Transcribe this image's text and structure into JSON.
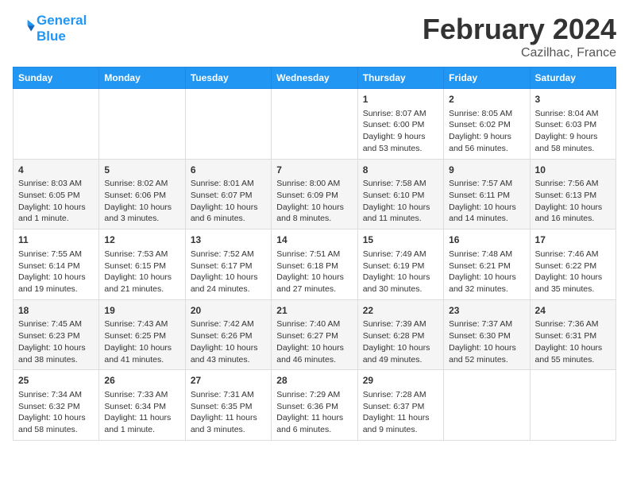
{
  "header": {
    "logo_line1": "General",
    "logo_line2": "Blue",
    "title": "February 2024",
    "subtitle": "Cazilhac, France"
  },
  "weekdays": [
    "Sunday",
    "Monday",
    "Tuesday",
    "Wednesday",
    "Thursday",
    "Friday",
    "Saturday"
  ],
  "weeks": [
    [
      {
        "day": "",
        "info": ""
      },
      {
        "day": "",
        "info": ""
      },
      {
        "day": "",
        "info": ""
      },
      {
        "day": "",
        "info": ""
      },
      {
        "day": "1",
        "info": "Sunrise: 8:07 AM\nSunset: 6:00 PM\nDaylight: 9 hours\nand 53 minutes."
      },
      {
        "day": "2",
        "info": "Sunrise: 8:05 AM\nSunset: 6:02 PM\nDaylight: 9 hours\nand 56 minutes."
      },
      {
        "day": "3",
        "info": "Sunrise: 8:04 AM\nSunset: 6:03 PM\nDaylight: 9 hours\nand 58 minutes."
      }
    ],
    [
      {
        "day": "4",
        "info": "Sunrise: 8:03 AM\nSunset: 6:05 PM\nDaylight: 10 hours\nand 1 minute."
      },
      {
        "day": "5",
        "info": "Sunrise: 8:02 AM\nSunset: 6:06 PM\nDaylight: 10 hours\nand 3 minutes."
      },
      {
        "day": "6",
        "info": "Sunrise: 8:01 AM\nSunset: 6:07 PM\nDaylight: 10 hours\nand 6 minutes."
      },
      {
        "day": "7",
        "info": "Sunrise: 8:00 AM\nSunset: 6:09 PM\nDaylight: 10 hours\nand 8 minutes."
      },
      {
        "day": "8",
        "info": "Sunrise: 7:58 AM\nSunset: 6:10 PM\nDaylight: 10 hours\nand 11 minutes."
      },
      {
        "day": "9",
        "info": "Sunrise: 7:57 AM\nSunset: 6:11 PM\nDaylight: 10 hours\nand 14 minutes."
      },
      {
        "day": "10",
        "info": "Sunrise: 7:56 AM\nSunset: 6:13 PM\nDaylight: 10 hours\nand 16 minutes."
      }
    ],
    [
      {
        "day": "11",
        "info": "Sunrise: 7:55 AM\nSunset: 6:14 PM\nDaylight: 10 hours\nand 19 minutes."
      },
      {
        "day": "12",
        "info": "Sunrise: 7:53 AM\nSunset: 6:15 PM\nDaylight: 10 hours\nand 21 minutes."
      },
      {
        "day": "13",
        "info": "Sunrise: 7:52 AM\nSunset: 6:17 PM\nDaylight: 10 hours\nand 24 minutes."
      },
      {
        "day": "14",
        "info": "Sunrise: 7:51 AM\nSunset: 6:18 PM\nDaylight: 10 hours\nand 27 minutes."
      },
      {
        "day": "15",
        "info": "Sunrise: 7:49 AM\nSunset: 6:19 PM\nDaylight: 10 hours\nand 30 minutes."
      },
      {
        "day": "16",
        "info": "Sunrise: 7:48 AM\nSunset: 6:21 PM\nDaylight: 10 hours\nand 32 minutes."
      },
      {
        "day": "17",
        "info": "Sunrise: 7:46 AM\nSunset: 6:22 PM\nDaylight: 10 hours\nand 35 minutes."
      }
    ],
    [
      {
        "day": "18",
        "info": "Sunrise: 7:45 AM\nSunset: 6:23 PM\nDaylight: 10 hours\nand 38 minutes."
      },
      {
        "day": "19",
        "info": "Sunrise: 7:43 AM\nSunset: 6:25 PM\nDaylight: 10 hours\nand 41 minutes."
      },
      {
        "day": "20",
        "info": "Sunrise: 7:42 AM\nSunset: 6:26 PM\nDaylight: 10 hours\nand 43 minutes."
      },
      {
        "day": "21",
        "info": "Sunrise: 7:40 AM\nSunset: 6:27 PM\nDaylight: 10 hours\nand 46 minutes."
      },
      {
        "day": "22",
        "info": "Sunrise: 7:39 AM\nSunset: 6:28 PM\nDaylight: 10 hours\nand 49 minutes."
      },
      {
        "day": "23",
        "info": "Sunrise: 7:37 AM\nSunset: 6:30 PM\nDaylight: 10 hours\nand 52 minutes."
      },
      {
        "day": "24",
        "info": "Sunrise: 7:36 AM\nSunset: 6:31 PM\nDaylight: 10 hours\nand 55 minutes."
      }
    ],
    [
      {
        "day": "25",
        "info": "Sunrise: 7:34 AM\nSunset: 6:32 PM\nDaylight: 10 hours\nand 58 minutes."
      },
      {
        "day": "26",
        "info": "Sunrise: 7:33 AM\nSunset: 6:34 PM\nDaylight: 11 hours\nand 1 minute."
      },
      {
        "day": "27",
        "info": "Sunrise: 7:31 AM\nSunset: 6:35 PM\nDaylight: 11 hours\nand 3 minutes."
      },
      {
        "day": "28",
        "info": "Sunrise: 7:29 AM\nSunset: 6:36 PM\nDaylight: 11 hours\nand 6 minutes."
      },
      {
        "day": "29",
        "info": "Sunrise: 7:28 AM\nSunset: 6:37 PM\nDaylight: 11 hours\nand 9 minutes."
      },
      {
        "day": "",
        "info": ""
      },
      {
        "day": "",
        "info": ""
      }
    ]
  ]
}
